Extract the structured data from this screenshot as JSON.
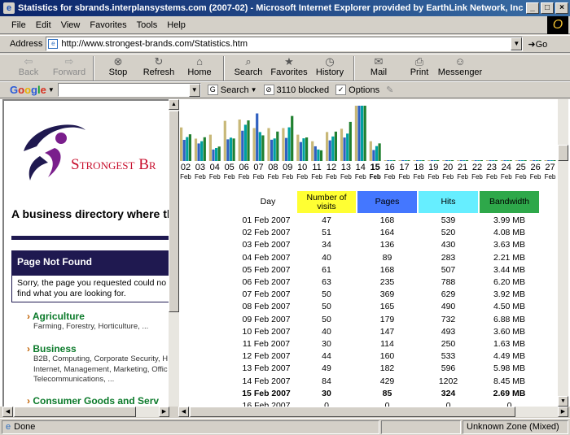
{
  "window": {
    "title": "Statistics for sbrands.interplansystems.com (2007-02) - Microsoft Internet Explorer provided by EarthLink Network, Inc"
  },
  "menu": [
    "File",
    "Edit",
    "View",
    "Favorites",
    "Tools",
    "Help"
  ],
  "address": {
    "label": "Address",
    "url": "http://www.strongest-brands.com/Statistics.htm",
    "go": "Go"
  },
  "toolbar": [
    {
      "label": "Back",
      "icon": "back-arrow-icon",
      "enabled": false
    },
    {
      "label": "Forward",
      "icon": "forward-arrow-icon",
      "enabled": false
    },
    {
      "label": "Stop",
      "icon": "stop-icon",
      "enabled": true
    },
    {
      "label": "Refresh",
      "icon": "refresh-icon",
      "enabled": true
    },
    {
      "label": "Home",
      "icon": "home-icon",
      "enabled": true
    },
    {
      "label": "Search",
      "icon": "search-icon",
      "enabled": true
    },
    {
      "label": "Favorites",
      "icon": "favorites-icon",
      "enabled": true
    },
    {
      "label": "History",
      "icon": "history-icon",
      "enabled": true
    },
    {
      "label": "Mail",
      "icon": "mail-icon",
      "enabled": true
    },
    {
      "label": "Print",
      "icon": "print-icon",
      "enabled": true
    },
    {
      "label": "Messenger",
      "icon": "messenger-icon",
      "enabled": true
    }
  ],
  "google_bar": {
    "logo": "Google",
    "search": "Search",
    "blocked": "3110 blocked",
    "options": "Options"
  },
  "left": {
    "logo_text": "Strongest Br",
    "tagline": "A business directory where th",
    "notfound_title": "Page Not Found",
    "notfound_text": [
      "Sorry, the page you requested could no",
      "find what you are looking for."
    ],
    "categories": [
      {
        "title": "Agriculture",
        "subs": [
          "Farming, Forestry, Horticulture, ..."
        ]
      },
      {
        "title": "Business",
        "subs": [
          "B2B, Computing, Corporate Security, H",
          "Internet, Management, Marketing, Offic",
          "Telecommunications, ..."
        ]
      },
      {
        "title": "Consumer Goods and Serv",
        "subs": []
      }
    ]
  },
  "chart_data": {
    "type": "bar",
    "categories": [
      "02",
      "03",
      "04",
      "05",
      "06",
      "07",
      "08",
      "09",
      "10",
      "11",
      "12",
      "13",
      "14",
      "15",
      "16",
      "17",
      "18",
      "19",
      "20",
      "21",
      "22",
      "23",
      "24",
      "25",
      "26",
      "27"
    ],
    "month_label": "Feb",
    "current_day": "15",
    "series": [
      {
        "name": "Number of visits",
        "color": "#c8b878",
        "values": [
          51,
          34,
          40,
          61,
          63,
          50,
          50,
          50,
          40,
          30,
          44,
          49,
          84,
          30,
          0,
          0,
          0,
          0,
          0,
          0,
          0,
          0,
          0,
          0,
          0,
          0
        ]
      },
      {
        "name": "Pages",
        "color": "#3060c0",
        "values": [
          164,
          136,
          89,
          168,
          235,
          369,
          165,
          179,
          147,
          114,
          160,
          182,
          429,
          85,
          0,
          0,
          0,
          0,
          0,
          0,
          0,
          0,
          0,
          0,
          0,
          0
        ]
      },
      {
        "name": "Hits",
        "color": "#00a0a0",
        "values": [
          520,
          430,
          283,
          507,
          788,
          629,
          490,
          732,
          493,
          250,
          533,
          596,
          1202,
          324,
          0,
          0,
          0,
          0,
          0,
          0,
          0,
          0,
          0,
          0,
          0,
          0
        ]
      },
      {
        "name": "Bandwidth",
        "color": "#208030",
        "values": [
          4.08,
          3.63,
          2.21,
          3.44,
          6.2,
          3.92,
          4.5,
          6.88,
          3.6,
          1.63,
          4.49,
          5.98,
          8.45,
          2.69,
          0,
          0,
          0,
          0,
          0,
          0,
          0,
          0,
          0,
          0,
          0,
          0
        ]
      }
    ]
  },
  "table": {
    "headers": {
      "day": "Day",
      "visits": "Number of visits",
      "pages": "Pages",
      "hits": "Hits",
      "bandwidth": "Bandwidth"
    },
    "header_colors": {
      "visits": "#ffff33",
      "pages": "#4477ff",
      "hits": "#66eeff",
      "bandwidth": "#2ea84a"
    },
    "rows": [
      {
        "day": "01 Feb 2007",
        "visits": "47",
        "pages": "168",
        "hits": "539",
        "bw": "3.99 MB",
        "bold": false
      },
      {
        "day": "02 Feb 2007",
        "visits": "51",
        "pages": "164",
        "hits": "520",
        "bw": "4.08 MB",
        "bold": false
      },
      {
        "day": "03 Feb 2007",
        "visits": "34",
        "pages": "136",
        "hits": "430",
        "bw": "3.63 MB",
        "bold": false
      },
      {
        "day": "04 Feb 2007",
        "visits": "40",
        "pages": "89",
        "hits": "283",
        "bw": "2.21 MB",
        "bold": false
      },
      {
        "day": "05 Feb 2007",
        "visits": "61",
        "pages": "168",
        "hits": "507",
        "bw": "3.44 MB",
        "bold": false
      },
      {
        "day": "06 Feb 2007",
        "visits": "63",
        "pages": "235",
        "hits": "788",
        "bw": "6.20 MB",
        "bold": false
      },
      {
        "day": "07 Feb 2007",
        "visits": "50",
        "pages": "369",
        "hits": "629",
        "bw": "3.92 MB",
        "bold": false
      },
      {
        "day": "08 Feb 2007",
        "visits": "50",
        "pages": "165",
        "hits": "490",
        "bw": "4.50 MB",
        "bold": false
      },
      {
        "day": "09 Feb 2007",
        "visits": "50",
        "pages": "179",
        "hits": "732",
        "bw": "6.88 MB",
        "bold": false
      },
      {
        "day": "10 Feb 2007",
        "visits": "40",
        "pages": "147",
        "hits": "493",
        "bw": "3.60 MB",
        "bold": false
      },
      {
        "day": "11 Feb 2007",
        "visits": "30",
        "pages": "114",
        "hits": "250",
        "bw": "1.63 MB",
        "bold": false
      },
      {
        "day": "12 Feb 2007",
        "visits": "44",
        "pages": "160",
        "hits": "533",
        "bw": "4.49 MB",
        "bold": false
      },
      {
        "day": "13 Feb 2007",
        "visits": "49",
        "pages": "182",
        "hits": "596",
        "bw": "5.98 MB",
        "bold": false
      },
      {
        "day": "14 Feb 2007",
        "visits": "84",
        "pages": "429",
        "hits": "1202",
        "bw": "8.45 MB",
        "bold": false
      },
      {
        "day": "15 Feb 2007",
        "visits": "30",
        "pages": "85",
        "hits": "324",
        "bw": "2.69 MB",
        "bold": true
      },
      {
        "day": "16 Feb 2007",
        "visits": "0",
        "pages": "0",
        "hits": "0",
        "bw": "0",
        "bold": false
      }
    ]
  },
  "status": {
    "text": "Done",
    "zone": "Unknown Zone (Mixed)"
  }
}
